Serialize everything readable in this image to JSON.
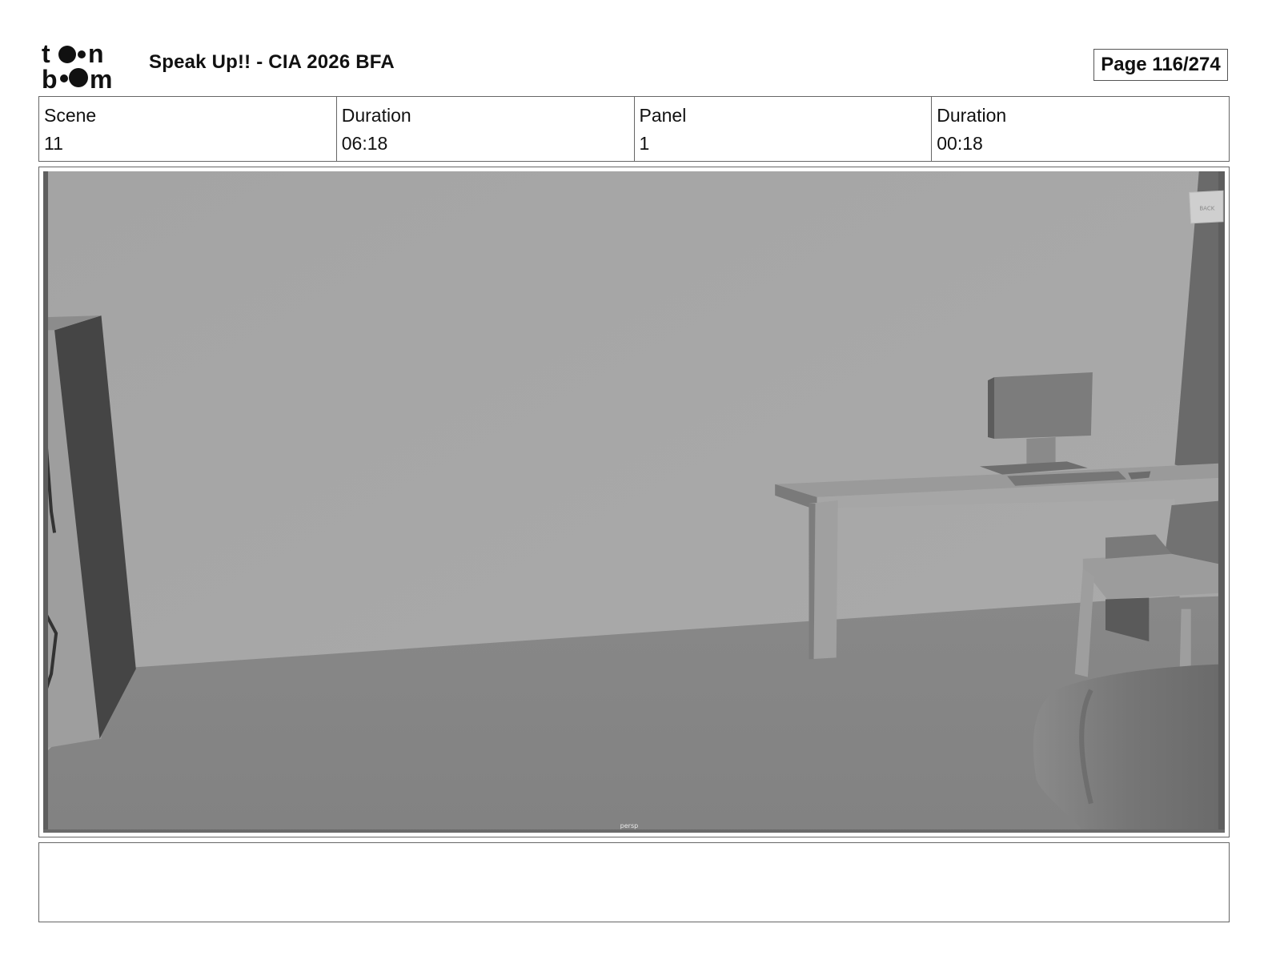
{
  "header": {
    "logo_text": "toonboom",
    "title": "Speak Up!! - CIA 2026 BFA",
    "page_label": "Page 116/274"
  },
  "info": [
    {
      "label": "Scene",
      "value": "11"
    },
    {
      "label": "Duration",
      "value": "06:18"
    },
    {
      "label": "Panel",
      "value": "1"
    },
    {
      "label": "Duration",
      "value": "00:18"
    }
  ],
  "panel": {
    "camera_label": "persp",
    "viewcube_label": "BACK",
    "colors": {
      "wall": "#a8a8a8",
      "floor": "#858585",
      "door_frame": "#454545",
      "desk": "#a3a3a3"
    }
  },
  "notes": {
    "text": ""
  }
}
